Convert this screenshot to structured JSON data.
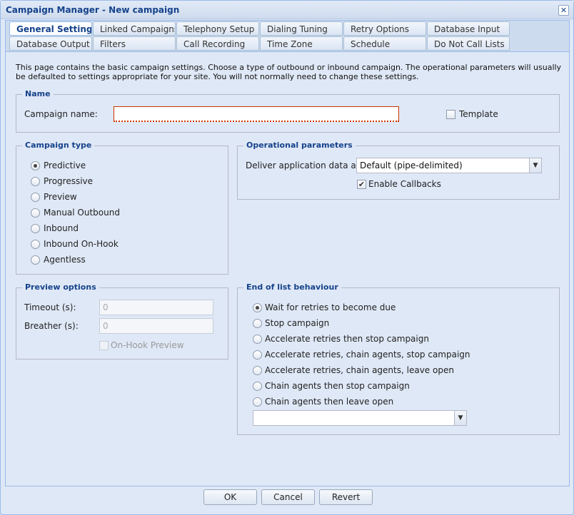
{
  "window": {
    "title": "Campaign Manager - New campaign",
    "close": "✕"
  },
  "tabs": {
    "row1": [
      "General Settings",
      "Linked Campaigns",
      "Telephony Setup",
      "Dialing Tuning",
      "Retry Options",
      "Database Input"
    ],
    "row2": [
      "Database Output",
      "Filters",
      "Call Recording",
      "Time Zone",
      "Schedule",
      "Do Not Call Lists"
    ],
    "active": "General Settings"
  },
  "intro": "This page contains the basic campaign settings. Choose a type of outbound or inbound campaign. The operational parameters will usually be defaulted to settings appropriate for your site. You will not normally need to change these settings.",
  "name_section": {
    "legend": "Name",
    "campaign_name_label": "Campaign name:",
    "campaign_name_value": "",
    "template_label": "Template",
    "template_checked": false
  },
  "campaign_type": {
    "legend": "Campaign type",
    "options": [
      "Predictive",
      "Progressive",
      "Preview",
      "Manual Outbound",
      "Inbound",
      "Inbound On-Hook",
      "Agentless"
    ],
    "selected": "Predictive"
  },
  "operational": {
    "legend": "Operational parameters",
    "deliver_label": "Deliver application data as:",
    "deliver_value": "Default (pipe-delimited)",
    "callbacks_label": "Enable Callbacks",
    "callbacks_checked": true
  },
  "preview_options": {
    "legend": "Preview options",
    "timeout_label": "Timeout (s):",
    "timeout_value": "0",
    "breather_label": "Breather (s):",
    "breather_value": "0",
    "onhook_label": "On-Hook Preview",
    "onhook_checked": false
  },
  "end_of_list": {
    "legend": "End of list behaviour",
    "options": [
      "Wait for retries to become due",
      "Stop campaign",
      "Accelerate retries then stop campaign",
      "Accelerate retries, chain agents, stop campaign",
      "Accelerate retries, chain agents, leave open",
      "Chain agents then stop campaign",
      "Chain agents then leave open"
    ],
    "selected": "Wait for retries to become due",
    "chain_campaign_value": ""
  },
  "buttons": {
    "ok": "OK",
    "cancel": "Cancel",
    "revert": "Revert"
  },
  "icons": {
    "dropdown": "chevron-down-icon",
    "checkmark": "✔"
  }
}
